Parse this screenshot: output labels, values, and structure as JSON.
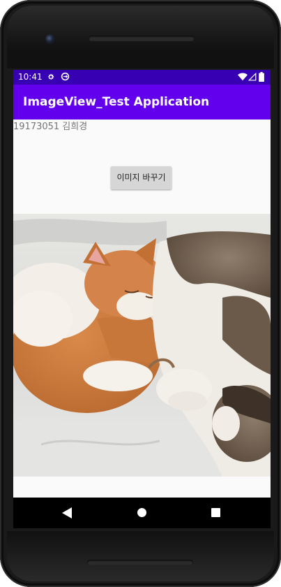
{
  "status_bar": {
    "time": "10:41",
    "background": "#3700b3",
    "icons": [
      "gear-icon",
      "sync-icon",
      "wifi-icon",
      "signal-icon",
      "battery-icon"
    ]
  },
  "app_bar": {
    "title": "ImageView_Test Application",
    "background": "#6200ee"
  },
  "content": {
    "student_label": "19173051 김희경",
    "change_image_button": "이미지 바꾸기",
    "image_subject": "two cats sleeping on a white blanket"
  },
  "nav_bar": {
    "icons": [
      "back-icon",
      "home-icon",
      "recents-icon"
    ]
  }
}
